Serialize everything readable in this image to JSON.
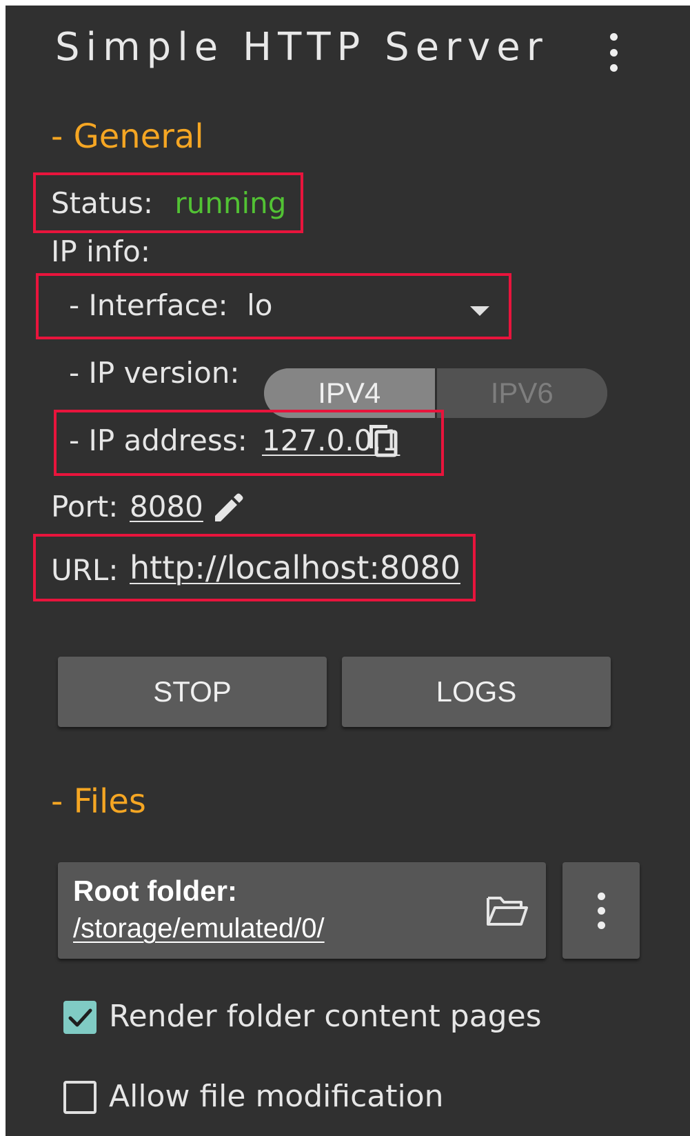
{
  "app": {
    "title": "Simple HTTP Server"
  },
  "general": {
    "section_title": "- General",
    "status_label": "Status:",
    "status_value": "running",
    "ip_info_label": "IP info:",
    "interface_label": "- Interface:",
    "interface_value": "lo",
    "ip_version_label": "- IP version:",
    "ip_version_options": [
      "IPV4",
      "IPV6"
    ],
    "ip_version_selected": "IPV4",
    "ip_address_label": "- IP address:",
    "ip_address_value": "127.0.0.1",
    "port_label": "Port:",
    "port_value": "8080",
    "url_label": "URL:",
    "url_value": "http://localhost:8080"
  },
  "actions": {
    "stop_label": "STOP",
    "logs_label": "LOGS"
  },
  "files": {
    "section_title": "- Files",
    "root_folder_label": "Root folder:",
    "root_folder_path": "/storage/emulated/0/",
    "render_pages_label": "Render folder content pages",
    "render_pages_checked": true,
    "allow_modification_label": "Allow file modification",
    "allow_modification_checked": false
  },
  "icons": {
    "overflow_menu": "more-vert-icon",
    "dropdown": "dropdown-arrow-icon",
    "copy": "copy-icon",
    "edit": "pencil-icon",
    "folder": "folder-open-icon",
    "checkmark": "check-icon"
  },
  "colors": {
    "background": "#303030",
    "section_accent": "#f5a623",
    "status_running": "#52c234",
    "highlight": "#e8143c",
    "checkbox_checked": "#80cbc4"
  }
}
